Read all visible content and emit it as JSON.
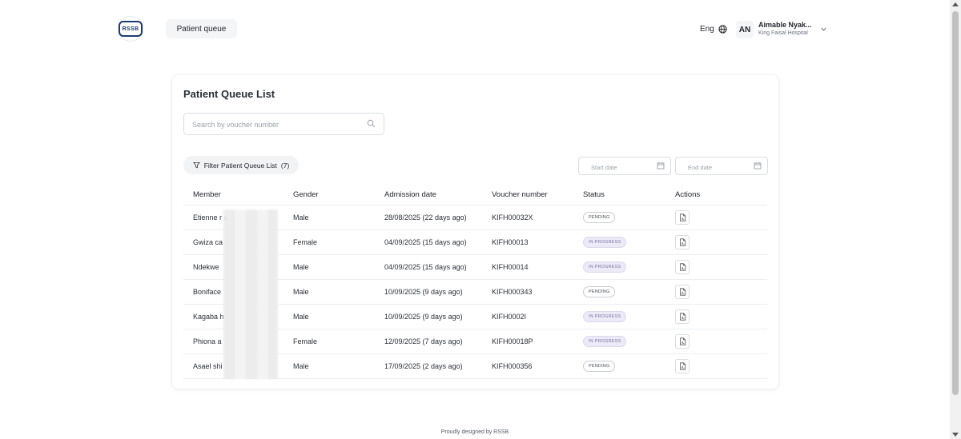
{
  "header": {
    "logo_text": "RSSB",
    "nav_tab": "Patient queue",
    "language": "Eng",
    "avatar_initials": "AN",
    "user_name": "Aimable Nyak...",
    "user_org": "King Faisal Hospital"
  },
  "card": {
    "title": "Patient Queue List",
    "search_placeholder": "Search by voucher number",
    "filter_label": "Filter Patient Queue List",
    "filter_count": "(7)",
    "start_date_placeholder": "Start date",
    "end_date_placeholder": "End date"
  },
  "table": {
    "columns": [
      "Member",
      "Gender",
      "Admission date",
      "Voucher number",
      "Status",
      "Actions"
    ],
    "rows": [
      {
        "member": "Etienne r                              a",
        "gender": "Male",
        "admission": "28/08/2025 (22 days ago)",
        "voucher": "KIFH00032X",
        "status": "PENDING"
      },
      {
        "member": "Gwiza ca",
        "gender": "Female",
        "admission": "04/09/2025 (15 days ago)",
        "voucher": "KIFH00013",
        "status": "IN PROGRESS"
      },
      {
        "member": "Ndekwe",
        "gender": "Male",
        "admission": "04/09/2025 (15 days ago)",
        "voucher": "KIFH00014",
        "status": "IN PROGRESS"
      },
      {
        "member": "Boniface",
        "gender": "Male",
        "admission": "10/09/2025 (9 days ago)",
        "voucher": "KIFH000343",
        "status": "PENDING"
      },
      {
        "member": "Kagaba h",
        "gender": "Male",
        "admission": "10/09/2025 (9 days ago)",
        "voucher": "KIFH0002I",
        "status": "IN PROGRESS"
      },
      {
        "member": "Phiona a",
        "gender": "Female",
        "admission": "12/09/2025 (7 days ago)",
        "voucher": "KIFH00018P",
        "status": "IN PROGRESS"
      },
      {
        "member": "Asael shi",
        "gender": "Male",
        "admission": "17/09/2025 (2 days ago)",
        "voucher": "KIFH000356",
        "status": "PENDING"
      }
    ]
  },
  "footer": "Proudly designed by RSSB",
  "colors": {
    "brand": "#1f3a6e",
    "badge_progress": "#7a75a8"
  }
}
